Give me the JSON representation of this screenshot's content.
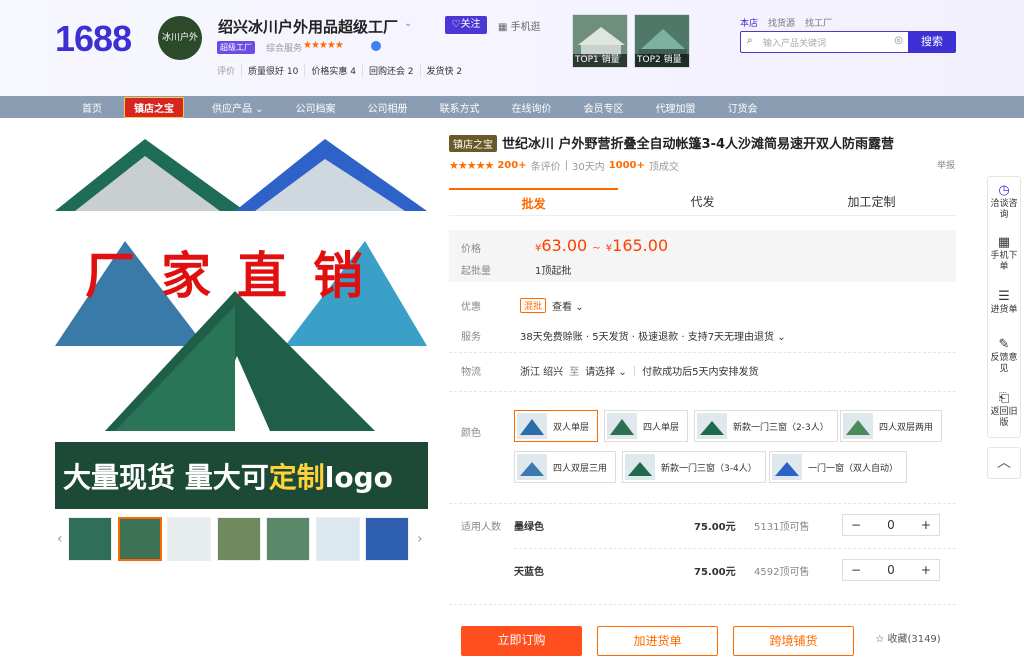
{
  "header": {
    "logo": "1688",
    "shop_logo_text": "冰川户外",
    "shop_name": "绍兴冰川户外用品超级工厂",
    "follow": "♡关注",
    "mobile": "手机逛",
    "badge": "超级工厂",
    "overall_service": "综合服务",
    "overall_stars": "★★★★★",
    "eval_label": "评价",
    "eval_tags": [
      "质量很好 10",
      "价格实惠 4",
      "回购还会 2",
      "发货快 2"
    ],
    "top_thumbs": [
      {
        "label": "TOP1 销量"
      },
      {
        "label": "TOP2 销量"
      }
    ],
    "links": [
      "本店",
      "找货源",
      "找工厂"
    ],
    "search_placeholder": "输入产品关键词",
    "search_button": "搜索"
  },
  "nav": {
    "items": [
      "首页",
      "镇店之宝",
      "供应产品 ⌄",
      "公司档案",
      "公司相册",
      "联系方式",
      "在线询价",
      "会员专区",
      "代理加盟",
      "订货会"
    ]
  },
  "gallery": {
    "main_overlay": "厂家直销",
    "banner_a": "大量现货 量大可",
    "banner_b": "定制",
    "banner_c": "logo",
    "prev_icon": "‹",
    "next_icon": "›"
  },
  "product": {
    "title_tag": "镇店之宝",
    "title": "世纪冰川 户外野营折叠全自动帐篷3-4人沙滩简易速开双人防雨露营",
    "stars": "★★★★★",
    "reviews_count": "200+",
    "reviews_label": "条评价",
    "sales_prefix": "30天内",
    "sales_count": "1000+",
    "sales_suffix": "顶成交",
    "report": "举报",
    "tabs": [
      "批发",
      "代发",
      "加工定制"
    ],
    "price_label": "价格",
    "price_low": "63.00",
    "price_high": "165.00",
    "price_sep": "~",
    "currency": "¥",
    "moq_label": "起批量",
    "moq": "1顶起批",
    "promo_label": "优惠",
    "promo_tag": "混批",
    "promo_view": "查看 ⌄",
    "service_label": "服务",
    "service_text": "38天免费赊账 · 5天发货 · 极速退款 · 支持7天无理由退货 ⌄",
    "logistics_label": "物流",
    "logistics_from": "浙江 绍兴",
    "logistics_to": "至",
    "logistics_select": "请选择 ⌄",
    "logistics_note": "付款成功后5天内安排发货",
    "color_label": "颜色",
    "colors": [
      "双人单层",
      "四人单层",
      "新款一门三窗（2-3人）",
      "四人双层两用",
      "四人双层三用",
      "新款一门三窗（3-4人）",
      "一门一窗（双人自动）"
    ],
    "sku_label": "适用人数",
    "skus": [
      {
        "name": "墨绿色",
        "price": "75.00元",
        "stock": "5131顶可售",
        "qty": "0"
      },
      {
        "name": "天蓝色",
        "price": "75.00元",
        "stock": "4592顶可售",
        "qty": "0"
      }
    ],
    "buy_now": "立即订购",
    "add_cart": "加进货单",
    "cross_border": "跨境铺货",
    "favorite": "☆ 收藏(3149)"
  },
  "sidebar": {
    "items": [
      "洽谈咨询",
      "手机下单",
      "进货单",
      "反馈意见",
      "返回旧版"
    ],
    "top_icon": "︿"
  },
  "colors": {
    "brand": "#3c2fd3",
    "accent": "#ff6a00",
    "price": "#ff4000",
    "nav": "#8a9db3"
  }
}
